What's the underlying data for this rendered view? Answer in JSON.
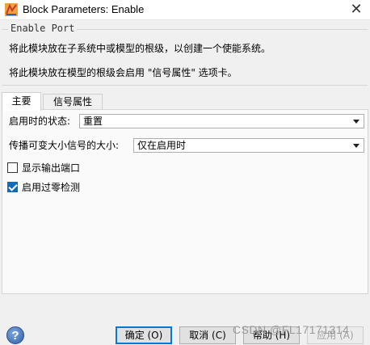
{
  "window": {
    "title": "Block Parameters: Enable",
    "close_glyph": "✕"
  },
  "group": {
    "title": "Enable Port",
    "line1": "将此模块放在子系统中或模型的根级，以创建一个使能系统。",
    "line2": "将此模块放在模型的根级会启用 \"信号属性\" 选项卡。"
  },
  "tabs": [
    {
      "label": "主要",
      "active": true
    },
    {
      "label": "信号属性",
      "active": false
    }
  ],
  "main": {
    "states_label": "启用时的状态:",
    "states_value": "重置",
    "propagate_label": "传播可变大小信号的大小:",
    "propagate_value": "仅在启用时",
    "show_output_label": "显示输出端口",
    "show_output_checked": false,
    "zero_cross_label": "启用过零检测",
    "zero_cross_checked": true
  },
  "buttons": {
    "help_glyph": "?",
    "ok": "确定 (O)",
    "cancel": "取消 (C)",
    "help": "帮助 (H)",
    "apply": "应用 (A)"
  },
  "watermark": "CSDN @FL17171314",
  "colors": {
    "accent": "#0078d7",
    "checkbox_checked": "#0f6cbd"
  }
}
